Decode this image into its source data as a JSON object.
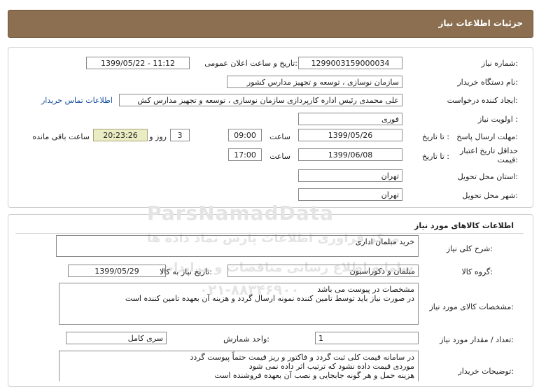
{
  "header": {
    "title": "جزئیات اطلاعات نیاز"
  },
  "details": {
    "need_number": {
      "label": "شماره نیاز:",
      "value": "1299003159000034"
    },
    "announce": {
      "label": "تاریخ و ساعت اعلان عمومی:",
      "value": "1399/05/22 - 11:12"
    },
    "buyer": {
      "label": "نام دستگاه خریدار:",
      "value": "سازمان نوسازی ، توسعه و تجهیز مدارس کشور"
    },
    "creator": {
      "label": "ایجاد کننده درخواست:",
      "value": "علی محمدی رئیس اداره کارپردازی سازمان نوسازی ، توسعه و تجهیز مدارس کش",
      "contact_link": "اطلاعات تماس خریدار"
    },
    "priority": {
      "label": "اولویت نیاز :",
      "value": "فوری"
    },
    "deadline": {
      "label": "مهلت ارسال پاسخ:",
      "to_date_label": "تا تاریخ :",
      "date": "1399/05/26",
      "time_label": "ساعت",
      "time": "09:00",
      "days": "3",
      "days_label": "روز و",
      "remaining": "20:23:26",
      "remaining_label": "ساعت باقی مانده"
    },
    "validity": {
      "label": "حداقل تاریخ اعتبار قیمت:",
      "to_date_label": "تا تاریخ :",
      "date": "1399/06/08",
      "time_label": "ساعت",
      "time": "17:00"
    },
    "province": {
      "label": "استان محل تحویل:",
      "value": "تهران"
    },
    "city": {
      "label": "شهر محل تحویل:",
      "value": "تهران"
    }
  },
  "watermark": {
    "line1": "ParsNamadData",
    "line2": "مرکز فراوری اطلاعات پارس نماد داده ها",
    "line3": "سامانه اطلاع رسانی مناقصات و مزایدات",
    "line4": "۰۲۱-۸۸۳۴۶۹۰۰"
  },
  "goods": {
    "title": "اطلاعات کالاهای مورد نیاز",
    "description": {
      "label": "شرح کلی نیاز:",
      "value": "خرید مبلمان اداری"
    },
    "group": {
      "label": "گروه کالا:",
      "value": "مبلمان و دکوراسیون",
      "need_date_label": "تاریخ نیاز به کالا:",
      "need_date": "1399/05/29"
    },
    "specs": {
      "label": "مشخصات کالای مورد نیاز:",
      "lines": [
        "مشخصات در پیوست می باشد",
        "در صورت نیاز باید توسط تامین کننده نمونه ارسال گردد و هزینه آن بعهده تامین کننده است"
      ]
    },
    "quantity": {
      "label": "تعداد / مقدار مورد نیاز:",
      "value": "1",
      "unit_label": "واحد شمارش:",
      "unit": "سری کامل"
    },
    "buyer_notes": {
      "label": "توضیحات خریدار:",
      "lines": [
        "در سامانه قیمت کلی ثبت گردد و فاکتور و ریز قیمت حتماً پیوست گردد",
        "موردی قیمت داده نشود که ترتیب اثر داده نمی شود",
        "هزینه حمل و هر گونه جابجایی و نصب آن بعهده فروشنده است"
      ]
    }
  }
}
